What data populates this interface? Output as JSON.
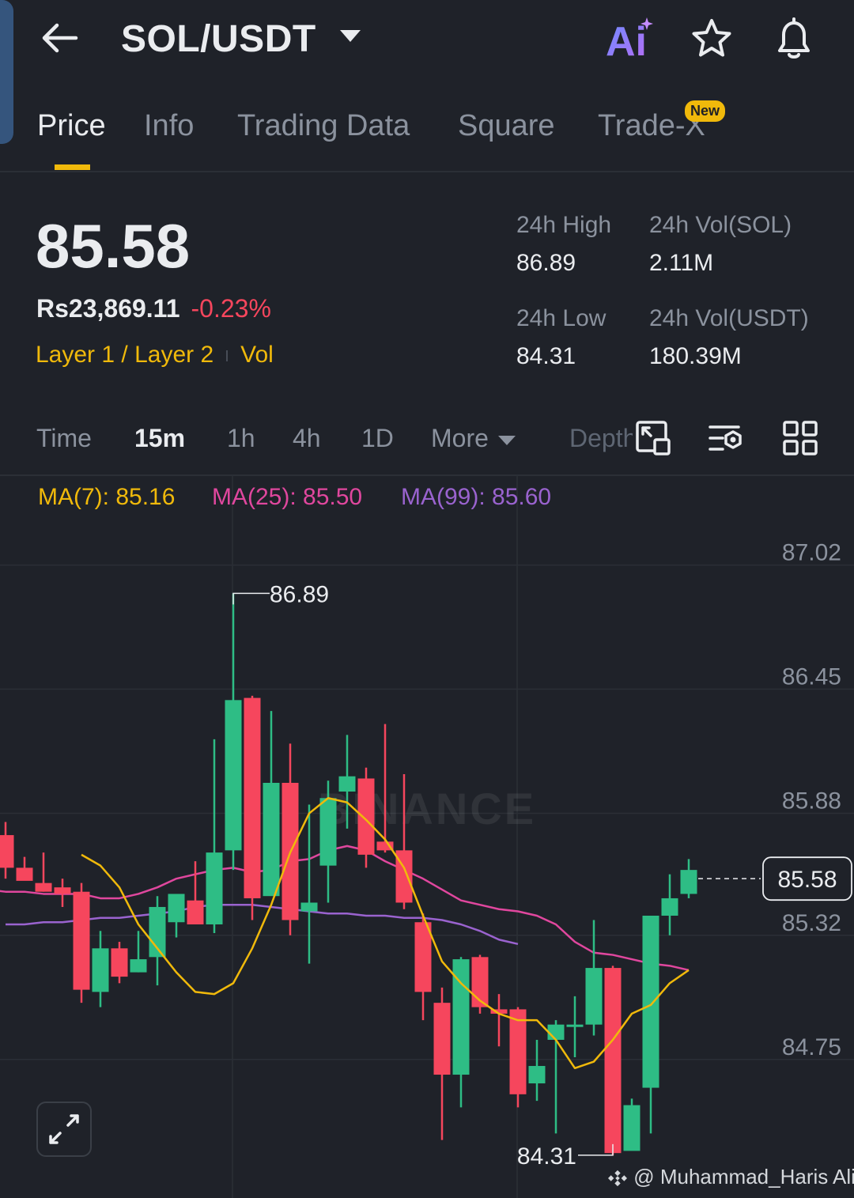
{
  "header": {
    "pair": "SOL/USDT",
    "ai_label": "Ai"
  },
  "tabs": [
    {
      "label": "Price",
      "active": true
    },
    {
      "label": "Info"
    },
    {
      "label": "Trading Data"
    },
    {
      "label": "Square"
    },
    {
      "label": "Trade-X",
      "badge": "New"
    }
  ],
  "ticker": {
    "last_price": "85.58",
    "fiat_price": "Rs23,869.11",
    "change": "-0.23%",
    "category": "Layer 1 / Layer 2",
    "category2": "Vol",
    "high_label": "24h High",
    "high": "86.89",
    "vol_sol_label": "24h Vol(SOL)",
    "vol_sol": "2.11M",
    "low_label": "24h Low",
    "low": "84.31",
    "vol_usdt_label": "24h Vol(USDT)",
    "vol_usdt": "180.39M"
  },
  "intervals": {
    "time": "Time",
    "m15": "15m",
    "h1": "1h",
    "h4": "4h",
    "d1": "1D",
    "more": "More",
    "depth": "Depth"
  },
  "indicators": {
    "ma7": "MA(7): 85.16",
    "ma25": "MA(25): 85.50",
    "ma99": "MA(99): 85.60"
  },
  "colors": {
    "up": "#2ebd85",
    "down": "#f6465d",
    "accent": "#f0b90b",
    "ma7": "#f0b90b",
    "ma25": "#e0479e",
    "ma99": "#9a63cf"
  },
  "chart_data": {
    "type": "candlestick",
    "y_ticks": [
      "87.02",
      "86.45",
      "85.88",
      "85.32",
      "84.75"
    ],
    "ylim": [
      84.15,
      87.2
    ],
    "last_price_label": "85.58",
    "last_price": 85.58,
    "high_label": "86.89",
    "high": 86.89,
    "low_label": "84.31",
    "low": 84.31,
    "watermark": "BINANCE",
    "candles": [
      {
        "o": 85.78,
        "h": 85.84,
        "l": 85.58,
        "c": 85.63
      },
      {
        "o": 85.63,
        "h": 85.68,
        "l": 85.59,
        "c": 85.57
      },
      {
        "o": 85.56,
        "h": 85.7,
        "l": 85.52,
        "c": 85.52
      },
      {
        "o": 85.54,
        "h": 85.58,
        "l": 85.45,
        "c": 85.51
      },
      {
        "o": 85.52,
        "h": 85.56,
        "l": 85.01,
        "c": 85.07
      },
      {
        "o": 85.06,
        "h": 85.34,
        "l": 84.99,
        "c": 85.26
      },
      {
        "o": 85.26,
        "h": 85.29,
        "l": 85.1,
        "c": 85.13
      },
      {
        "o": 85.15,
        "h": 85.34,
        "l": 85.15,
        "c": 85.21
      },
      {
        "o": 85.22,
        "h": 85.5,
        "l": 85.09,
        "c": 85.45
      },
      {
        "o": 85.38,
        "h": 85.5,
        "l": 85.31,
        "c": 85.51
      },
      {
        "o": 85.48,
        "h": 85.66,
        "l": 85.37,
        "c": 85.37
      },
      {
        "o": 85.37,
        "h": 86.22,
        "l": 85.33,
        "c": 85.7
      },
      {
        "o": 85.71,
        "h": 86.89,
        "l": 85.62,
        "c": 86.4
      },
      {
        "o": 86.41,
        "h": 86.42,
        "l": 85.39,
        "c": 85.49
      },
      {
        "o": 85.5,
        "h": 86.35,
        "l": 85.52,
        "c": 86.02
      },
      {
        "o": 86.02,
        "h": 86.2,
        "l": 85.32,
        "c": 85.39
      },
      {
        "o": 85.43,
        "h": 85.92,
        "l": 85.19,
        "c": 85.47
      },
      {
        "o": 85.64,
        "h": 86.03,
        "l": 85.47,
        "c": 85.95
      },
      {
        "o": 85.98,
        "h": 86.24,
        "l": 85.81,
        "c": 86.05
      },
      {
        "o": 86.04,
        "h": 86.09,
        "l": 85.63,
        "c": 85.69
      },
      {
        "o": 85.75,
        "h": 86.29,
        "l": 85.7,
        "c": 85.71
      },
      {
        "o": 85.71,
        "h": 86.06,
        "l": 85.44,
        "c": 85.47
      },
      {
        "o": 85.38,
        "h": 85.42,
        "l": 84.93,
        "c": 85.06
      },
      {
        "o": 85.01,
        "h": 85.08,
        "l": 84.38,
        "c": 84.68
      },
      {
        "o": 84.68,
        "h": 85.22,
        "l": 84.53,
        "c": 85.21
      },
      {
        "o": 85.22,
        "h": 85.23,
        "l": 84.96,
        "c": 84.99
      },
      {
        "o": 84.98,
        "h": 85.05,
        "l": 84.81,
        "c": 84.96
      },
      {
        "o": 84.98,
        "h": 84.99,
        "l": 84.53,
        "c": 84.59
      },
      {
        "o": 84.64,
        "h": 84.84,
        "l": 84.56,
        "c": 84.72
      },
      {
        "o": 84.84,
        "h": 84.93,
        "l": 84.41,
        "c": 84.91
      },
      {
        "o": 84.91,
        "h": 85.04,
        "l": 84.76,
        "c": 84.91
      },
      {
        "o": 84.91,
        "h": 85.39,
        "l": 84.86,
        "c": 85.17
      },
      {
        "o": 85.17,
        "h": 85.18,
        "l": 84.31,
        "c": 84.32
      },
      {
        "o": 84.33,
        "h": 84.57,
        "l": 84.34,
        "c": 84.54
      },
      {
        "o": 84.62,
        "h": 85.15,
        "l": 84.41,
        "c": 85.41
      },
      {
        "o": 85.41,
        "h": 85.6,
        "l": 85.32,
        "c": 85.49
      },
      {
        "o": 85.51,
        "h": 85.67,
        "l": 85.49,
        "c": 85.62
      }
    ],
    "ma7": [
      85.69,
      85.64,
      85.54,
      85.37,
      85.26,
      85.15,
      85.06,
      85.05,
      85.1,
      85.26,
      85.46,
      85.7,
      85.88,
      85.95,
      85.93,
      85.85,
      85.76,
      85.63,
      85.41,
      85.2,
      85.1,
      85.02,
      84.96,
      84.93,
      84.93,
      84.84,
      84.71,
      84.74,
      84.84,
      84.96,
      85.0,
      85.1,
      85.16
    ],
    "ma25": [
      85.54,
      85.53,
      85.52,
      85.52,
      85.51,
      85.51,
      85.51,
      85.49,
      85.49,
      85.51,
      85.54,
      85.58,
      85.6,
      85.62,
      85.63,
      85.61,
      85.62,
      85.66,
      85.67,
      85.71,
      85.73,
      85.71,
      85.66,
      85.62,
      85.58,
      85.53,
      85.48,
      85.46,
      85.44,
      85.43,
      85.41,
      85.37,
      85.29,
      85.24,
      85.23,
      85.21,
      85.19,
      85.18,
      85.16
    ],
    "ma99": [
      85.37,
      85.37,
      85.38,
      85.38,
      85.39,
      85.4,
      85.4,
      85.41,
      85.42,
      85.43,
      85.45,
      85.46,
      85.46,
      85.46,
      85.45,
      85.44,
      85.43,
      85.42,
      85.42,
      85.41,
      85.41,
      85.4,
      85.4,
      85.39,
      85.37,
      85.34,
      85.3,
      85.28
    ]
  },
  "footer": {
    "attribution": "@ Muhammad_Haris Ali"
  }
}
